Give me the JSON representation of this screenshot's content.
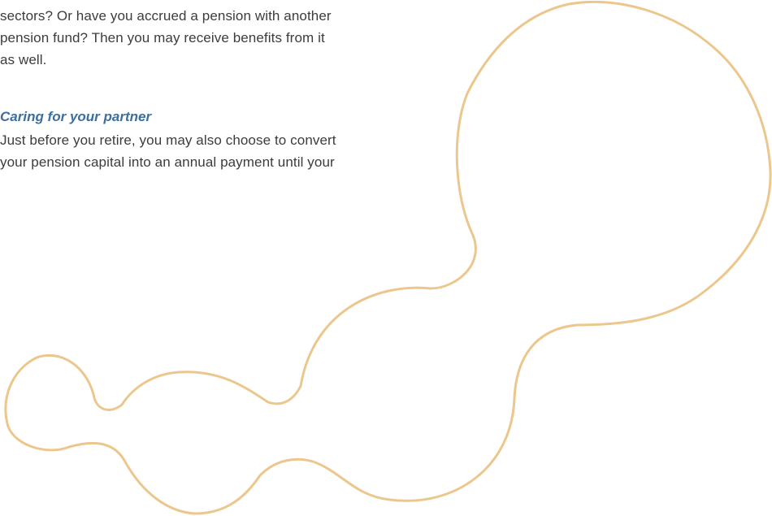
{
  "colors": {
    "body_text": "#3c3c3c",
    "heading": "#3d6f9c",
    "decor_stroke": "#ecc78d"
  },
  "paragraph_1": {
    "lines": [
      "sectors? Or have you accrued a pension with another",
      "pension fund? Then you may receive benefits from it",
      "as well."
    ]
  },
  "section": {
    "heading": "Caring for your partner",
    "lines": [
      "Just before you retire, you may also choose to convert",
      "your pension capital into an annual payment until your"
    ]
  },
  "decoration": {
    "icon": "circles-outline-graphic"
  }
}
